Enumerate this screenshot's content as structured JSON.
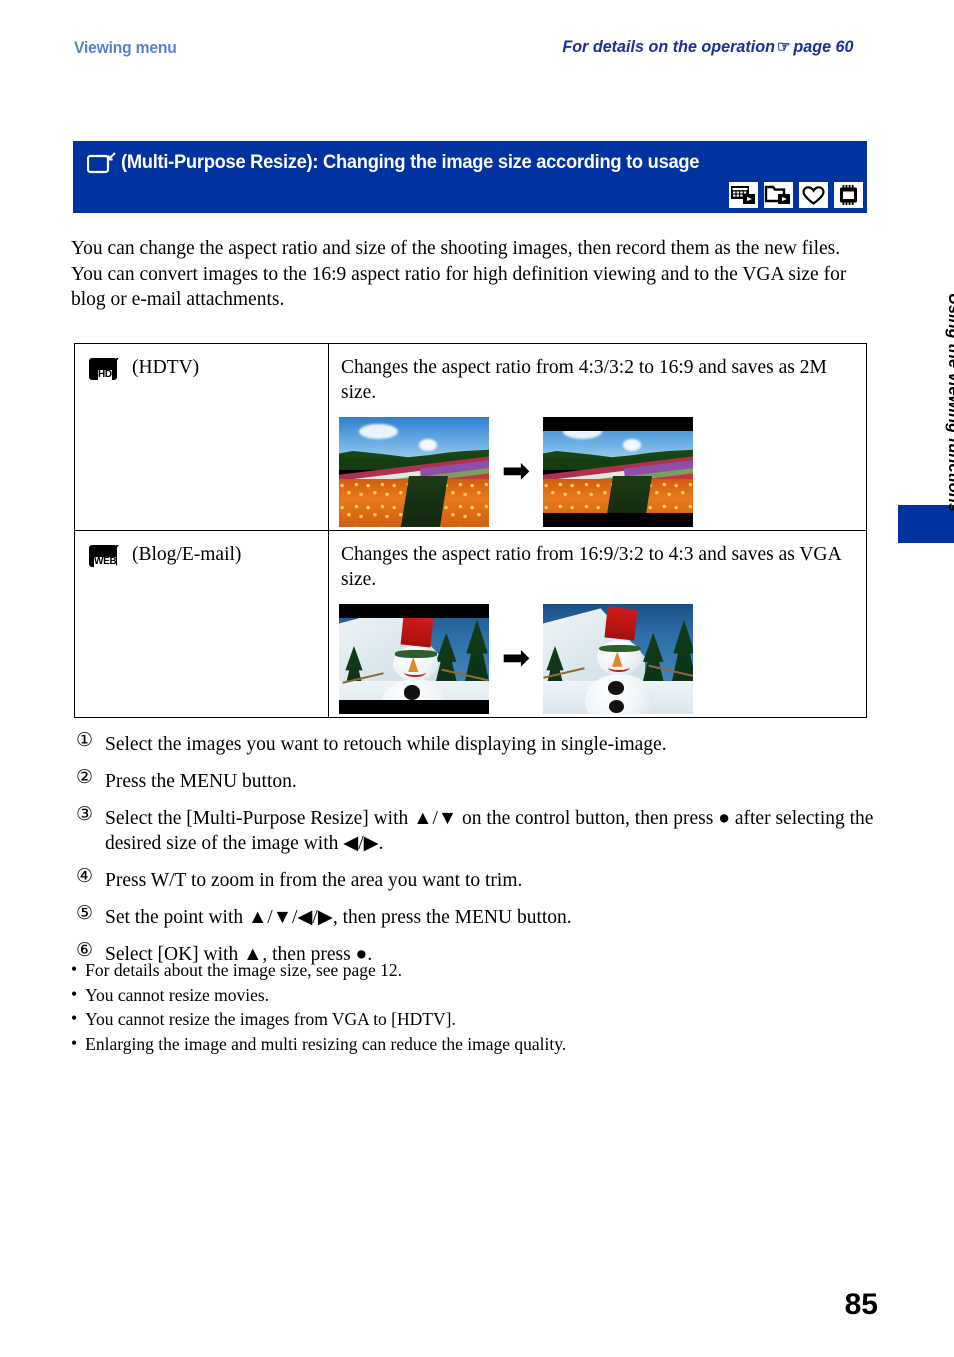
{
  "running_head": {
    "left": "Viewing menu",
    "right_prefix": "For details on the operation",
    "right_hand_icon": "pointing-hand-icon",
    "right_page": "page 60"
  },
  "banner": {
    "icon": "multi-purpose-resize-icon",
    "title": "(Multi-Purpose Resize): Changing the image size according to usage",
    "background_color": "#0033a0",
    "mode_icons": [
      {
        "name": "date-view-icon"
      },
      {
        "name": "folder-view-icon"
      },
      {
        "name": "favorites-heart-icon"
      },
      {
        "name": "memory-card-icon"
      }
    ]
  },
  "intro": {
    "line1": "You can change the aspect ratio and size of the shooting images, then record them as the new files.",
    "line2": "You can convert images to the 16:9 aspect ratio for high definition viewing and to the VGA size for blog or e-mail attachments."
  },
  "table": {
    "rows": [
      {
        "icon": "hdtv-resize-icon",
        "icon_tag": "HD",
        "option": "(HDTV)",
        "description": "Changes the aspect ratio from 4:3/3:2 to 16:9 and saves as 2M size.",
        "figure": {
          "before_alt": "flower-field-4to3-photo",
          "after_alt": "flower-field-16to9-photo",
          "arrow": "➡"
        }
      },
      {
        "icon": "blog-email-resize-icon",
        "icon_tag": "WEB",
        "option": "(Blog/E-mail)",
        "description": "Changes the aspect ratio from 16:9/3:2 to 4:3 and saves as VGA size.",
        "figure": {
          "before_alt": "snowman-16to9-photo",
          "after_alt": "snowman-4to3-photo",
          "arrow": "➡"
        }
      }
    ]
  },
  "steps": [
    {
      "num": "①",
      "text": "Select the images you want to retouch while displaying in single-image."
    },
    {
      "num": "②",
      "text": "Press the MENU button."
    },
    {
      "num": "③",
      "text": "Select the [Multi-Purpose Resize] with ▲/▼ on the control button, then press ● after selecting the desired size of the image with ◀/▶."
    },
    {
      "num": "④",
      "text": "Press W/T to zoom in from the area you want to trim."
    },
    {
      "num": "⑤",
      "text": "Set the point with ▲/▼/◀/▶, then press the MENU button."
    },
    {
      "num": "⑥",
      "text": "Select [OK] with ▲, then press ●."
    }
  ],
  "notes": [
    "For details about the image size, see page 12.",
    "You cannot resize movies.",
    "You cannot resize the images from VGA to [HDTV].",
    "Enlarging the image and multi resizing can reduce the image quality."
  ],
  "side_tab": {
    "label": "Using the viewing functions",
    "color": "#0033a0"
  },
  "page_number": "85"
}
